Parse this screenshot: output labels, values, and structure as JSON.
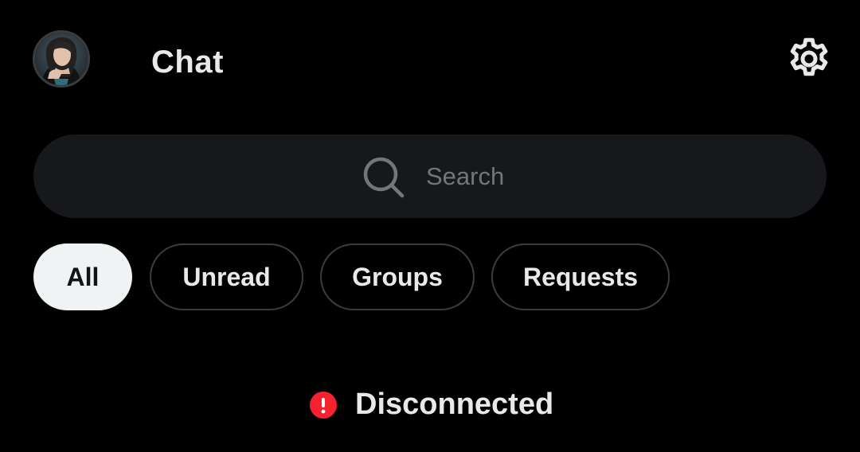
{
  "header": {
    "title": "Chat",
    "avatar_icon": "profile-avatar",
    "settings_icon": "gear-icon"
  },
  "search": {
    "placeholder": "Search",
    "icon": "search-icon"
  },
  "tabs": [
    {
      "label": "All",
      "active": true
    },
    {
      "label": "Unread",
      "active": false
    },
    {
      "label": "Groups",
      "active": false
    },
    {
      "label": "Requests",
      "active": false
    }
  ],
  "status": {
    "text": "Disconnected",
    "icon": "alert-icon",
    "color": "#f4212e"
  },
  "colors": {
    "background": "#000000",
    "surface": "#16181c",
    "text": "#e7e9ea",
    "muted": "#71767b",
    "active_tab_bg": "#eff3f4"
  }
}
